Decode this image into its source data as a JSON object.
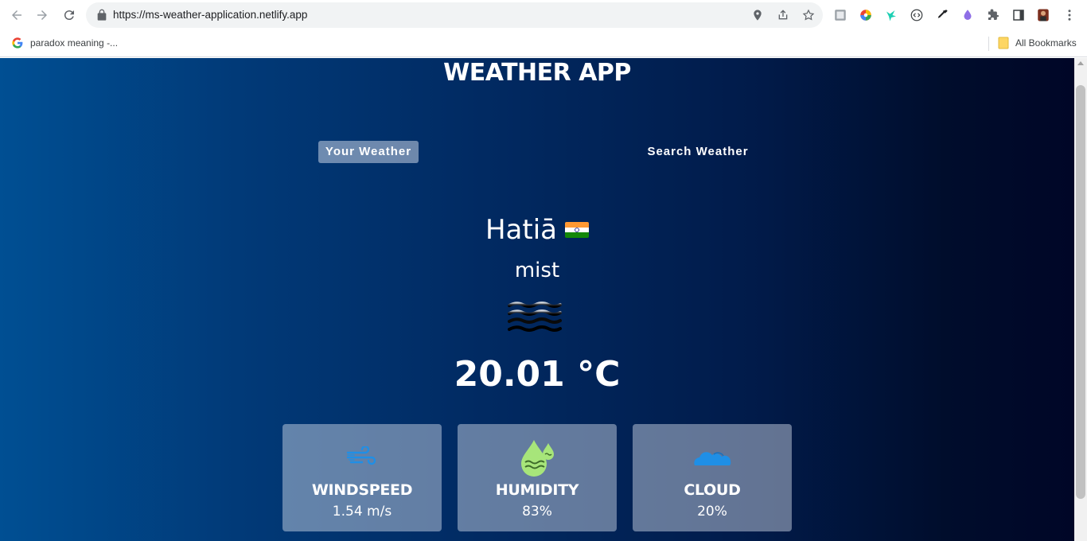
{
  "browser": {
    "url": "https://ms-weather-application.netlify.app",
    "bookmark": "paradox meaning -...",
    "all_bookmarks": "All Bookmarks"
  },
  "app": {
    "title": "WEATHER APP",
    "tabs": [
      {
        "label": "Your Weather",
        "active": true
      },
      {
        "label": "Search Weather",
        "active": false
      }
    ],
    "city": "Hatiā",
    "flag": "india-flag",
    "description": "mist",
    "weather_icon": "mist-icon",
    "temperature": "20.01 °C",
    "stats": [
      {
        "icon": "wind-icon",
        "label": "WINDSPEED",
        "value": "1.54 m/s"
      },
      {
        "icon": "humidity-icon",
        "label": "HUMIDITY",
        "value": "83%"
      },
      {
        "icon": "cloud-icon",
        "label": "CLOUD",
        "value": "20%"
      }
    ]
  },
  "colors": {
    "gradient_start": "#004f93",
    "gradient_end": "#000627",
    "card_bg": "rgba(219,226,239,0.45)",
    "wind_icon": "#1f8fe6",
    "humidity_icon": "#a7e57a",
    "cloud_icon": "#1f8fe6"
  }
}
